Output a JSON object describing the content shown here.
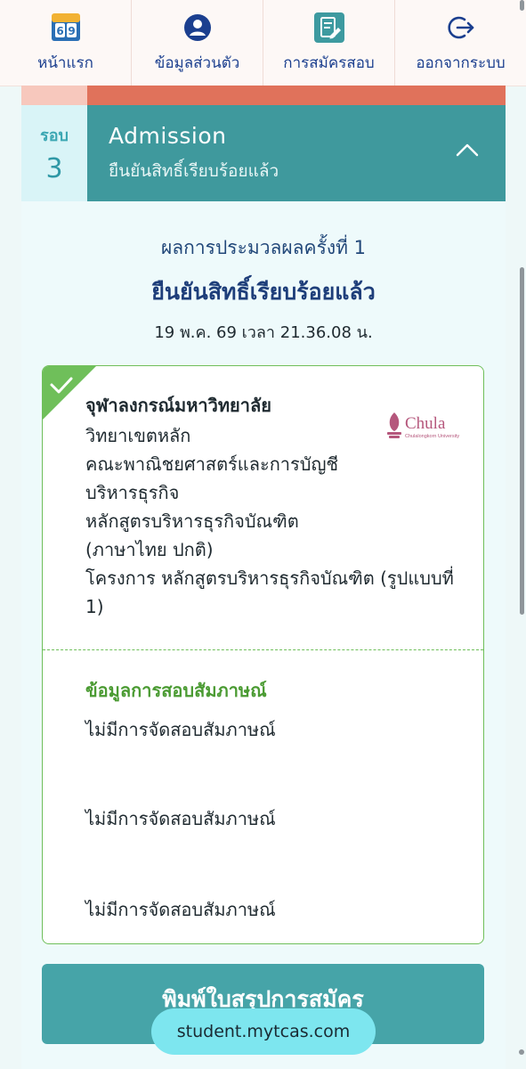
{
  "nav": {
    "items": [
      {
        "label": "หน้าแรก",
        "icon": "home-69-icon"
      },
      {
        "label": "ข้อมูลส่วนตัว",
        "icon": "user-circle-icon"
      },
      {
        "label": "การสมัครสอบ",
        "icon": "document-edit-icon"
      },
      {
        "label": "ออกจากระบบ",
        "icon": "logout-icon"
      }
    ]
  },
  "round": {
    "label": "รอบ",
    "number": "3",
    "title": "Admission",
    "subtitle": "ยืนยันสิทธิ์เรียบร้อยแล้ว"
  },
  "result": {
    "line1": "ผลการประมวลผลครั้งที่ 1",
    "status": "ยืนยันสิทธิ์เรียบร้อยแล้ว",
    "timestamp": "19 พ.ค. 69 เวลา 21.36.08 น."
  },
  "card": {
    "university": "จุฬาลงกรณ์มหาวิทยาลัย",
    "logo_text": "Chula",
    "logo_subtext": "Chulalongkorn University",
    "lines": [
      "วิทยาเขตหลัก",
      "คณะพาณิชยศาสตร์และการบัญชี",
      "บริหารธุรกิจ",
      "หลักสูตรบริหารธุรกิจบัณฑิต",
      "(ภาษาไทย ปกติ)",
      "โครงการ หลักสูตรบริหารธุรกิจบัณฑิต (รูปแบบที่",
      "1)"
    ],
    "interview_heading": "ข้อมูลการสอบสัมภาษณ์",
    "interview_items": [
      "ไม่มีการจัดสอบสัมภาษณ์",
      "ไม่มีการจัดสอบสัมภาษณ์",
      "ไม่มีการจัดสอบสัมภาษณ์"
    ]
  },
  "print_button": "พิมพ์ใบสรุปการสมัคร",
  "url": "student.mytcas.com",
  "colors": {
    "teal": "#3f999d",
    "salmon": "#e0725b",
    "green": "#6fbf5a",
    "navy": "#1b3f8f",
    "url_pill": "#7de6ef"
  }
}
